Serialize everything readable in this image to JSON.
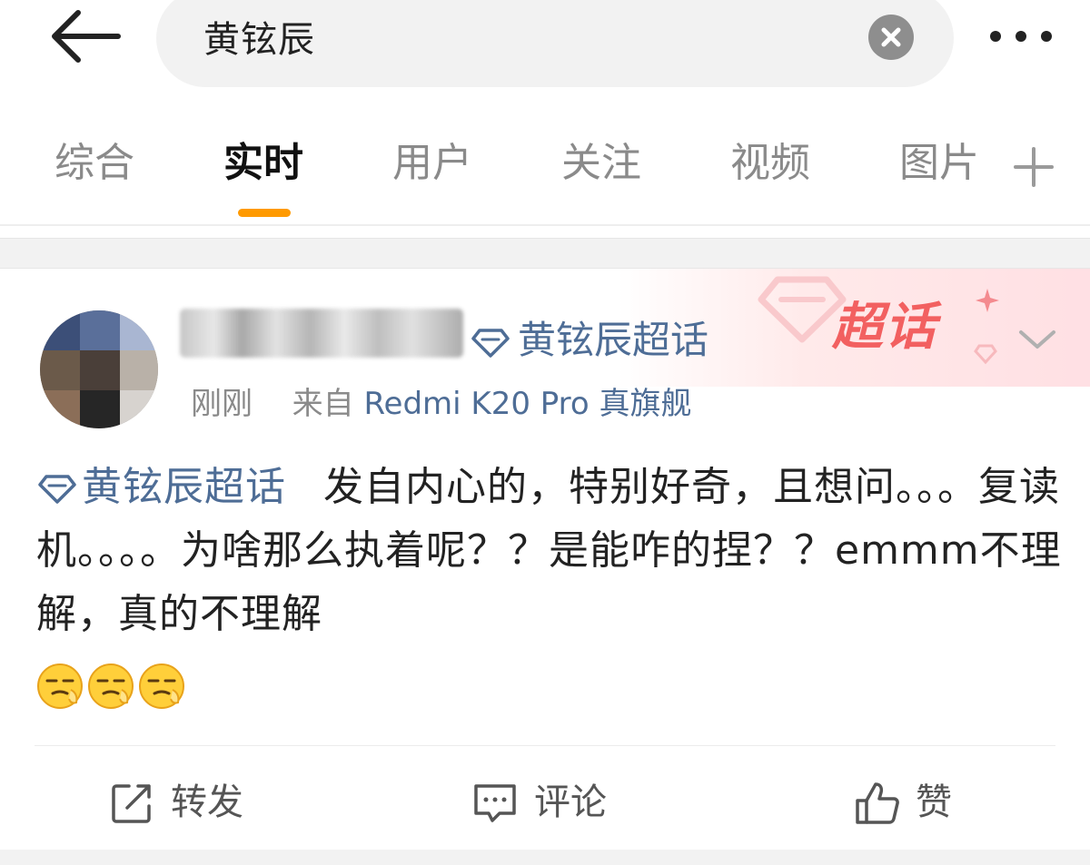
{
  "search": {
    "query": "黄铉辰"
  },
  "tabs": [
    {
      "label": "综合"
    },
    {
      "label": "实时"
    },
    {
      "label": "用户"
    },
    {
      "label": "关注"
    },
    {
      "label": "视频"
    },
    {
      "label": "图片"
    }
  ],
  "active_tab": "实时",
  "colors": {
    "accent_orange": "#ff9a00",
    "link_blue": "#4e6d96",
    "badge_red": "#f26060"
  },
  "post": {
    "supertopic_head": "黄铉辰超话",
    "badge_label": "超话",
    "time": "刚刚",
    "source_prefix": "来自",
    "source": "Redmi K20 Pro 真旗舰",
    "topic_tag": "黄铉辰超话",
    "text": "发自内心的，特别好奇，且想问。。。复读机。。。。为啥那么执着呢？？是能咋的捏？？emmm不理解，真的不理解",
    "emoji_name": "doge-sleepy-emoji",
    "emoji_count": 3
  },
  "actions": {
    "repost": "转发",
    "comment": "评论",
    "like": "赞"
  },
  "icons": {
    "back": "arrow-left-icon",
    "clear": "close-circle-icon",
    "more": "more-dots-icon",
    "add_tab": "plus-icon",
    "expand": "chevron-down-icon",
    "repost": "share-square-icon",
    "comment": "comment-bubble-icon",
    "like": "thumbs-up-icon",
    "supertopic": "diamond-icon"
  }
}
